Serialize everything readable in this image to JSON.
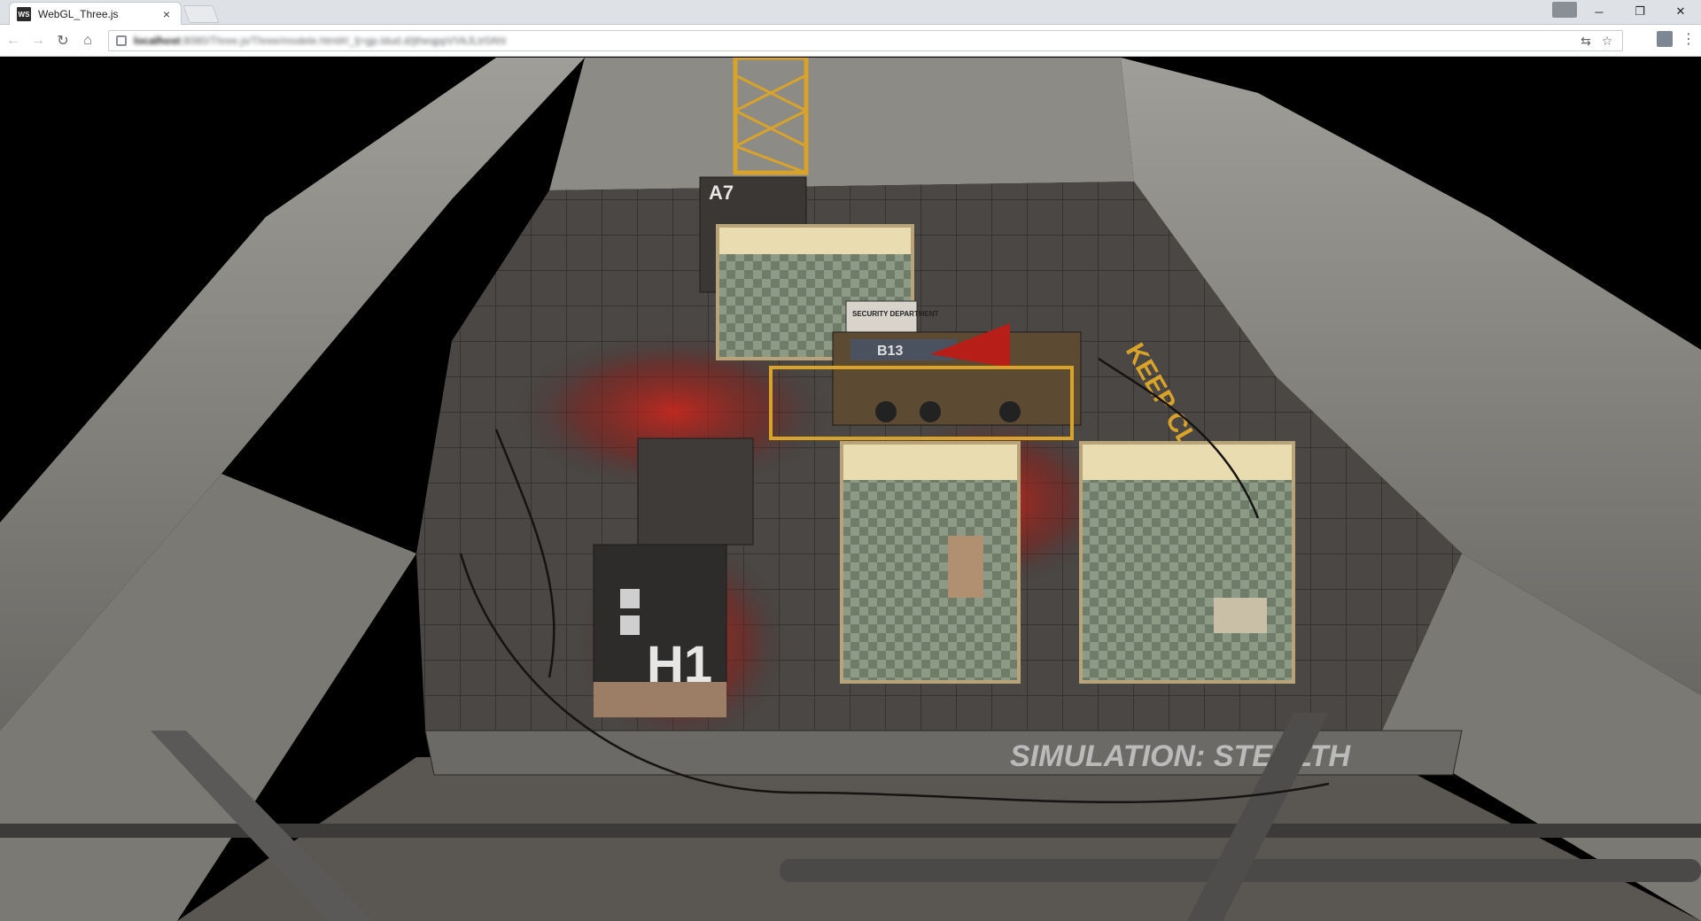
{
  "tab": {
    "title": "WebGL_Three.js",
    "favicon": "WS",
    "close": "×"
  },
  "window_controls": {
    "minimize": "─",
    "restore": "❐",
    "close": "✕"
  },
  "toolbar": {
    "back": "←",
    "forward": "→",
    "reload": "↻",
    "home": "⌂",
    "url_host": "localhost",
    "url_rest": ":8080/Three.js/Three/modele.html#/_lj=gp.ldud.d/jtheqppVVkJLtr0Ahl",
    "translate": "⇆",
    "bookmark": "☆",
    "menu": "⋮"
  },
  "scene": {
    "labels": {
      "a7": "A7",
      "b13": "B13",
      "h1": "H1",
      "security": "SECURITY DEPARTMENT",
      "keep_clear": "KEEP CLEA",
      "sim_stealth": "SIMULATION: STEALTH"
    },
    "colors": {
      "wall": "#8e8c86",
      "wall_dark": "#5e5c58",
      "floor": "#3b3836",
      "red_light": "#c8221a",
      "accent_yellow": "#d9a32a",
      "room_floor": "#7f8c7a"
    }
  }
}
